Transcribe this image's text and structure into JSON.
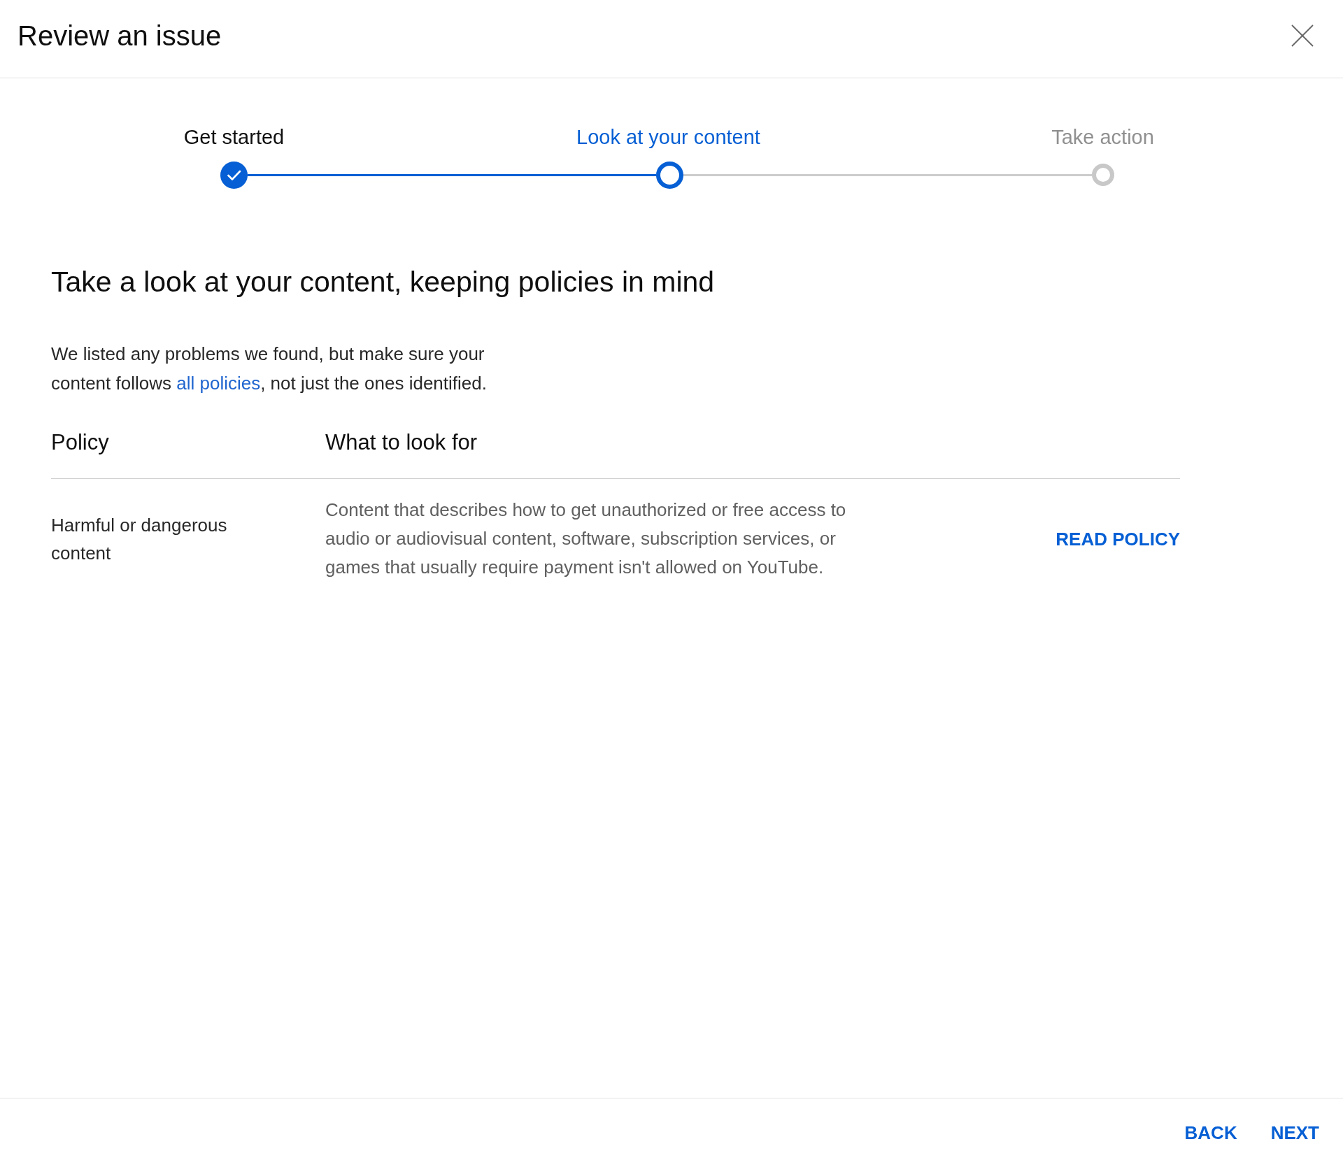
{
  "dialog": {
    "title": "Review an issue"
  },
  "steps": [
    {
      "label": "Get started",
      "completed": true,
      "selected": false
    },
    {
      "label": "Look at your content",
      "completed": false,
      "selected": true
    },
    {
      "label": "Take action",
      "completed": false,
      "selected": false
    }
  ],
  "heading": "Take a look at your content, keeping policies in mind",
  "intro": {
    "before": "We listed any problems we found, but make sure your content follows ",
    "link": "all policies",
    "after": ", not just the ones identified."
  },
  "table": {
    "columns": [
      "Policy",
      "What to look for"
    ],
    "rows": [
      {
        "policy": "Harmful or dangerous content",
        "description": "Content that describes how to get unauthorized or free access to audio or audiovisual content, software, subscription services, or games that usually require payment isn't allowed on YouTube.",
        "action": "READ POLICY"
      }
    ]
  },
  "footer": {
    "buttons": [
      "BACK",
      "NEXT"
    ]
  }
}
